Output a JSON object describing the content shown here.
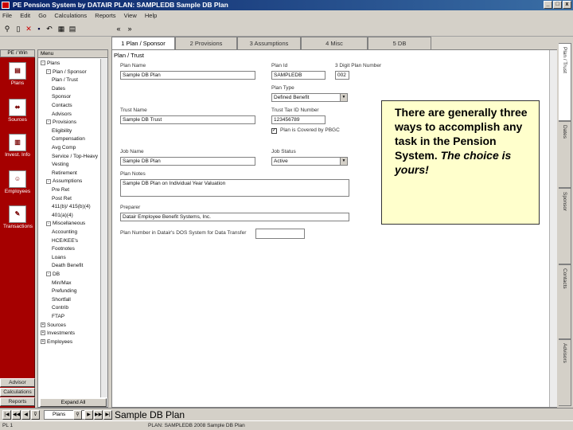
{
  "window": {
    "title": "PE  Pension System by DATAIR    PLAN: SAMPLEDB    Sample DB Plan",
    "minimize": "_",
    "maximize": "□",
    "close": "x"
  },
  "menu": [
    "File",
    "Edit",
    "Go",
    "Calculations",
    "Reports",
    "View",
    "Help"
  ],
  "toolbar": {
    "back": "«",
    "forward": "»"
  },
  "tabs": [
    "1 Plan / Sponsor",
    "2 Provisions",
    "3 Assumptions",
    "4 Misc",
    "5 DB"
  ],
  "sidebar": {
    "header": "PE / Win",
    "items": [
      {
        "label": "Plans",
        "icon": "plans-icon"
      },
      {
        "label": "Sources",
        "icon": "sources-icon"
      },
      {
        "label": "Invest. Info",
        "icon": "invest-icon"
      },
      {
        "label": "Employees",
        "icon": "employees-icon"
      },
      {
        "label": "Transactions",
        "icon": "transactions-icon"
      }
    ],
    "buttons": [
      "Advisor",
      "Calculations",
      "Reports"
    ]
  },
  "tree": {
    "header": "Menu",
    "expand_all": "Expand All",
    "items": [
      {
        "label": "Plans",
        "indent": 0,
        "toggle": "-"
      },
      {
        "label": "Plan / Sponsor",
        "indent": 1,
        "toggle": "-"
      },
      {
        "label": "Plan / Trust",
        "indent": 2,
        "toggle": ""
      },
      {
        "label": "Dates",
        "indent": 2,
        "toggle": ""
      },
      {
        "label": "Sponsor",
        "indent": 2,
        "toggle": ""
      },
      {
        "label": "Contacts",
        "indent": 2,
        "toggle": ""
      },
      {
        "label": "Advisors",
        "indent": 2,
        "toggle": ""
      },
      {
        "label": "Provisions",
        "indent": 1,
        "toggle": "-"
      },
      {
        "label": "Eligibility",
        "indent": 2,
        "toggle": ""
      },
      {
        "label": "Compensation",
        "indent": 2,
        "toggle": ""
      },
      {
        "label": "Avg Comp",
        "indent": 2,
        "toggle": ""
      },
      {
        "label": "Service / Top-Heavy",
        "indent": 2,
        "toggle": ""
      },
      {
        "label": "Vesting",
        "indent": 2,
        "toggle": ""
      },
      {
        "label": "Retirement",
        "indent": 2,
        "toggle": ""
      },
      {
        "label": "Assumptions",
        "indent": 1,
        "toggle": "-"
      },
      {
        "label": "Pre Ret",
        "indent": 2,
        "toggle": ""
      },
      {
        "label": "Post Ret",
        "indent": 2,
        "toggle": ""
      },
      {
        "label": "411(b)/ 415(b)(4)",
        "indent": 2,
        "toggle": ""
      },
      {
        "label": "401(a)(4)",
        "indent": 2,
        "toggle": ""
      },
      {
        "label": "Miscellaneous",
        "indent": 1,
        "toggle": "-"
      },
      {
        "label": "Accounting",
        "indent": 2,
        "toggle": ""
      },
      {
        "label": "HCE/KEE's",
        "indent": 2,
        "toggle": ""
      },
      {
        "label": "Footnotes",
        "indent": 2,
        "toggle": ""
      },
      {
        "label": "Loans",
        "indent": 2,
        "toggle": ""
      },
      {
        "label": "Death Benefit",
        "indent": 2,
        "toggle": ""
      },
      {
        "label": "DB",
        "indent": 1,
        "toggle": "-"
      },
      {
        "label": "Min/Max",
        "indent": 2,
        "toggle": ""
      },
      {
        "label": "Prefunding",
        "indent": 2,
        "toggle": ""
      },
      {
        "label": "Shortfall",
        "indent": 2,
        "toggle": ""
      },
      {
        "label": "Contrib",
        "indent": 2,
        "toggle": ""
      },
      {
        "label": "FTAP",
        "indent": 2,
        "toggle": ""
      },
      {
        "label": "Sources",
        "indent": 0,
        "toggle": "+"
      },
      {
        "label": "Investments",
        "indent": 0,
        "toggle": "+"
      },
      {
        "label": "Employees",
        "indent": 0,
        "toggle": "+"
      }
    ]
  },
  "form": {
    "section_title": "Plan / Trust",
    "plan_name_label": "Plan Name",
    "plan_name": "Sample DB Plan",
    "plan_id_label": "Plan Id",
    "plan_id": "SAMPLEDB",
    "plan_number_label": "3 Digit Plan Number",
    "plan_number": "002",
    "plan_type_label": "Plan Type",
    "plan_type": "Defined Benefit",
    "trust_name_label": "Trust Name",
    "trust_name": "Sample DB Trust",
    "trust_id_label": "Trust Tax ID Number",
    "trust_id": "123456789",
    "pbgc_label": "Plan is Covered by PBGC",
    "pbgc_checked": "✓",
    "job_name_label": "Job Name",
    "job_name": "Sample DB Plan",
    "job_status_label": "Job Status",
    "job_status": "Active",
    "plan_notes_label": "Plan Notes",
    "plan_notes": "Sample DB Plan on Individual Year Valuation",
    "preparer_label": "Preparer",
    "preparer": "Datair Employee Benefit Systems, Inc.",
    "dos_label": "Plan Number in Datair's DOS System for Data Transfer",
    "dos_value": ""
  },
  "right_tabs": [
    "Plan / Trust",
    "Dates",
    "Sponsor",
    "Contacts",
    "Advisors"
  ],
  "callout": {
    "line1": "There are generally three ways to accomplish any task in the Pension System.",
    "line2": "The choice is yours!"
  },
  "navbar": {
    "search": "Plans",
    "buttons": [
      "|◀",
      "◀◀",
      "◀",
      "▶",
      "▶▶",
      "▶|"
    ],
    "plan_title": "Sample DB Plan"
  },
  "status": {
    "left": "PL  1",
    "center": "PLAN: SAMPLEDB    2008    Sample DB Plan"
  },
  "colors": {
    "sidebar": "#a50000",
    "titlebar": "#0a246a",
    "callout": "#ffffcc"
  }
}
